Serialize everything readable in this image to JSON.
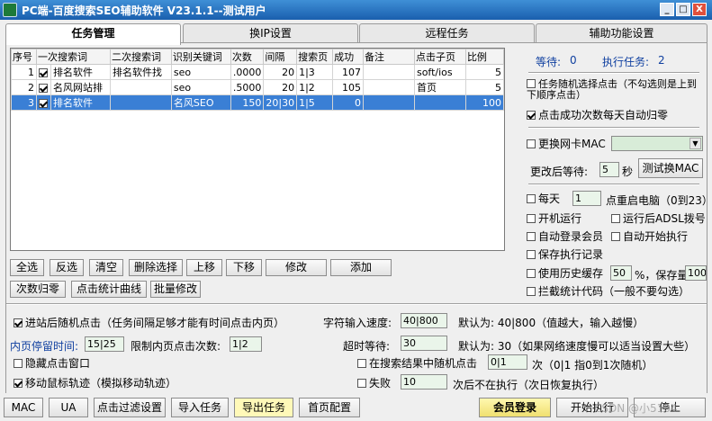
{
  "window": {
    "title": "PC端-百度搜索SEO辅助软件 V23.1.1--测试用户",
    "min": "_",
    "max": "□",
    "close": "X"
  },
  "tabs": [
    {
      "label": "任务管理"
    },
    {
      "label": "换IP设置"
    },
    {
      "label": "远程任务"
    },
    {
      "label": "辅助功能设置"
    }
  ],
  "grid": {
    "columns": [
      "序号",
      "一次搜索词",
      "二次搜索词",
      "识别关键词",
      "次数",
      "间隔",
      "搜索页",
      "成功",
      "备注",
      "点击子页",
      "比例"
    ],
    "rows": [
      {
        "no": "1",
        "checked": true,
        "kw1": "排名软件",
        "kw2": "排名软件找",
        "ident": "seo",
        "times": ".0000",
        "interval": "20",
        "page": "1|3",
        "success": "107",
        "note": "",
        "subpage": "soft/ios",
        "ratio": "5"
      },
      {
        "no": "2",
        "checked": true,
        "kw1": "名风网站排",
        "kw2": "",
        "ident": "seo",
        "times": ".5000",
        "interval": "20",
        "page": "1|2",
        "success": "105",
        "note": "",
        "subpage": "首页",
        "ratio": "5"
      },
      {
        "no": "3",
        "checked": true,
        "kw1": "排名软件",
        "kw2": "",
        "ident": "名风SEO",
        "times": "150",
        "interval": "20|30",
        "page": "1|5",
        "success": "0",
        "note": "",
        "subpage": "",
        "ratio": "100"
      }
    ]
  },
  "buttons_row1": [
    "全选",
    "反选",
    "清空",
    "删除选择",
    "上移",
    "下移",
    "修改",
    "添加"
  ],
  "buttons_row2": [
    "次数归零",
    "点击统计曲线",
    "批量修改"
  ],
  "right": {
    "wait_label": "等待:",
    "wait_value": "0",
    "exec_label": "执行任务:",
    "exec_value": "2",
    "random_click": "任务随机选择点击（不勾选则是上到下顺序点击）",
    "daily_reset": "点击成功次数每天自动归零",
    "change_mac": "更换网卡MAC",
    "after_change_wait": "更改后等待:",
    "after_change_value": "5",
    "seconds": "秒",
    "test_mac": "测试换MAC",
    "every_day": "每天",
    "restart_value": "1",
    "restart_label": "点重启电脑（0到23）",
    "startup_run": "开机运行",
    "adsl_dial": "运行后ADSL拨号",
    "auto_login": "自动登录会员",
    "auto_start": "自动开始执行",
    "save_log": "保存执行记录",
    "history_cache": "使用历史缓存",
    "history_value": "50",
    "keep_label": "%，保存量",
    "keep_value": "100",
    "block_stats": "拦截统计代码（一般不要勾选）"
  },
  "bottom": {
    "enter_random": "进站后随机点击（任务间隔足够才能有时间点击内页）",
    "char_speed_label": "字符输入速度:",
    "char_speed_value": "40|800",
    "char_speed_default": "默认为: 40|800（值越大，输入越慢）",
    "inner_stay_label": "内页停留时间:",
    "inner_stay_value": "15|25",
    "limit_inner_label": "限制内页点击次数:",
    "limit_inner_value": "1|2",
    "timeout_label": "超时等待:",
    "timeout_value": "30",
    "timeout_default": "默认为: 30（如果网络速度慢可以适当设置大些）",
    "hide_window": "隐藏点击窗口",
    "random_in_results": "在搜索结果中随机点击",
    "random_in_value": "0|1",
    "random_in_suffix": "次（0|1 指0到1次随机）",
    "mouse_move": "移动鼠标轨迹（模拟移动轨迹）",
    "fail": "失败",
    "fail_value": "10",
    "fail_suffix": "次后不在执行（次日恢复执行）"
  },
  "toolbar": [
    "MAC",
    "UA",
    "点击过滤设置",
    "导入任务",
    "导出任务",
    "首页配置"
  ],
  "member_login": "会员登录",
  "start_exec": "开始执行",
  "stop": "停止",
  "watermark": "CSDN @小5104"
}
